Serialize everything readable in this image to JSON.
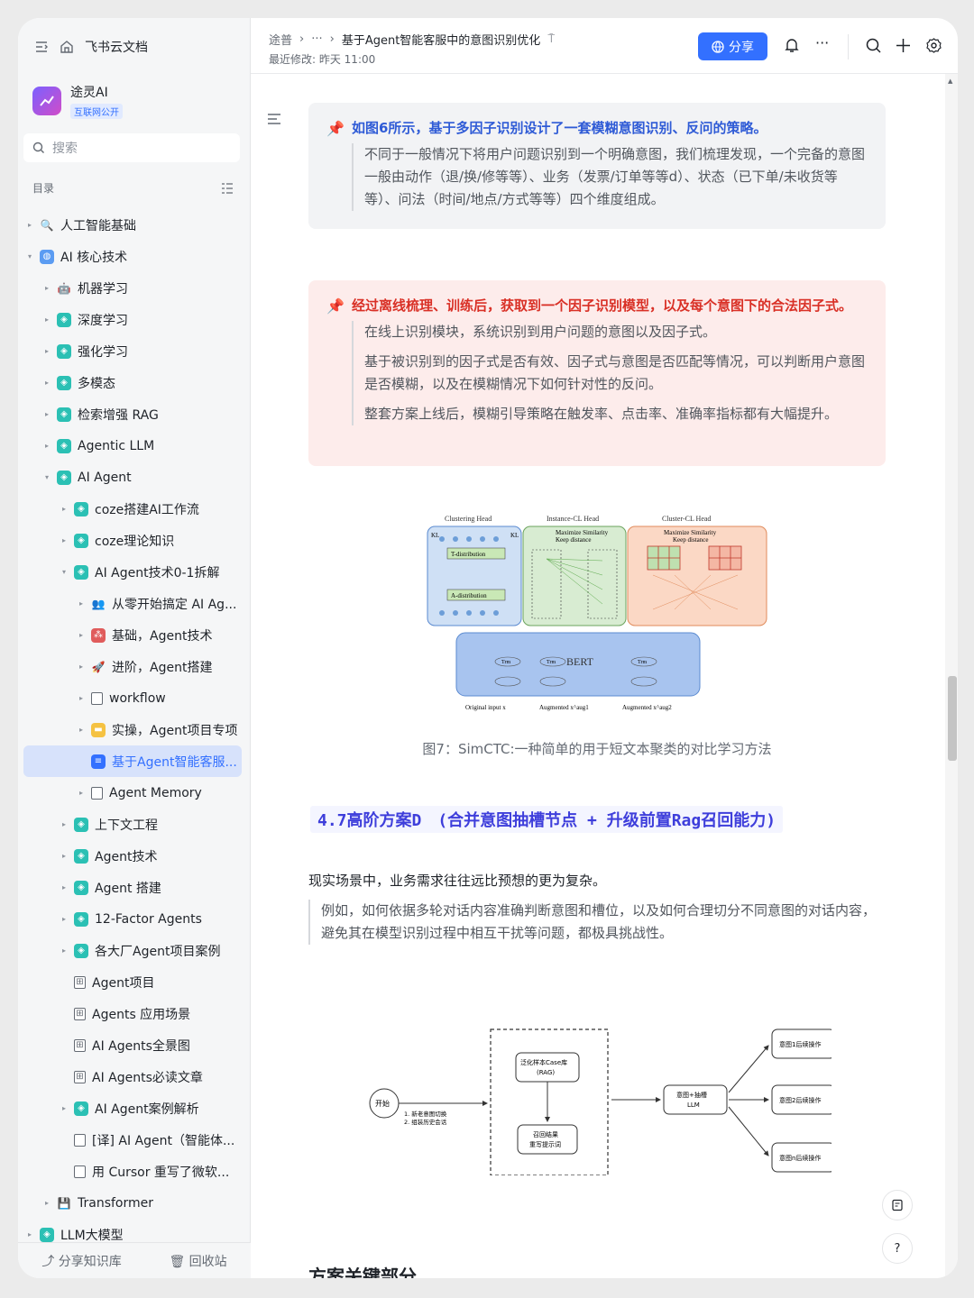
{
  "sidebar": {
    "app_name": "飞书云文档",
    "workspace": {
      "name": "途灵AI",
      "tag": "互联网公开"
    },
    "search_placeholder": "搜索",
    "toc_label": "目录",
    "tree": [
      {
        "label": "人工智能基础",
        "level": 0,
        "arrow": "▸",
        "icon": "search-icon"
      },
      {
        "label": "AI 核心技术",
        "level": 0,
        "arrow": "▾",
        "icon": "globe-icon"
      },
      {
        "label": "机器学习",
        "level": 1,
        "arrow": "▸",
        "icon": "robot-icon"
      },
      {
        "label": "深度学习",
        "level": 1,
        "arrow": "▸",
        "icon": "wiki-icon"
      },
      {
        "label": "强化学习",
        "level": 1,
        "arrow": "▸",
        "icon": "wiki-icon"
      },
      {
        "label": "多模态",
        "level": 1,
        "arrow": "▸",
        "icon": "wiki-icon"
      },
      {
        "label": "检索增强 RAG",
        "level": 1,
        "arrow": "▸",
        "icon": "wiki-icon"
      },
      {
        "label": "Agentic LLM",
        "level": 1,
        "arrow": "▸",
        "icon": "wiki-icon"
      },
      {
        "label": "AI Agent",
        "level": 1,
        "arrow": "▾",
        "icon": "wiki-icon"
      },
      {
        "label": "coze搭建AI工作流",
        "level": 2,
        "arrow": "▸",
        "icon": "wiki-icon"
      },
      {
        "label": "coze理论知识",
        "level": 2,
        "arrow": "▸",
        "icon": "wiki-icon"
      },
      {
        "label": "AI Agent技术0-1拆解",
        "level": 2,
        "arrow": "▾",
        "icon": "wiki-icon"
      },
      {
        "label": "从零开始搞定 AI Ag...",
        "level": 3,
        "arrow": "▸",
        "icon": "people-icon"
      },
      {
        "label": "基础，Agent技术",
        "level": 3,
        "arrow": "▸",
        "icon": "dots-icon"
      },
      {
        "label": "进阶，Agent搭建",
        "level": 3,
        "arrow": "▸",
        "icon": "rocket-icon"
      },
      {
        "label": "workflow",
        "level": 3,
        "arrow": "▸",
        "icon": "doc-icon"
      },
      {
        "label": "实操，Agent项目专项",
        "level": 3,
        "arrow": "▸",
        "icon": "note-icon"
      },
      {
        "label": "基于Agent智能客服...",
        "level": 3,
        "arrow": "",
        "icon": "doc-blue-icon",
        "active": true
      },
      {
        "label": "Agent Memory",
        "level": 3,
        "arrow": "▸",
        "icon": "doc-icon"
      },
      {
        "label": "上下文工程",
        "level": 2,
        "arrow": "▸",
        "icon": "wiki-icon"
      },
      {
        "label": "Agent技术",
        "level": 2,
        "arrow": "▸",
        "icon": "wiki-icon"
      },
      {
        "label": "Agent 搭建",
        "level": 2,
        "arrow": "▸",
        "icon": "wiki-icon"
      },
      {
        "label": "12-Factor Agents",
        "level": 2,
        "arrow": "▸",
        "icon": "wiki-icon"
      },
      {
        "label": "各大厂Agent项目案例",
        "level": 2,
        "arrow": "▸",
        "icon": "wiki-icon"
      },
      {
        "label": "Agent项目",
        "level": 2,
        "arrow": "",
        "icon": "board-icon"
      },
      {
        "label": "Agents 应用场景",
        "level": 2,
        "arrow": "",
        "icon": "board-icon"
      },
      {
        "label": "AI Agents全景图",
        "level": 2,
        "arrow": "",
        "icon": "board-icon"
      },
      {
        "label": "AI Agents必读文章",
        "level": 2,
        "arrow": "",
        "icon": "board-icon"
      },
      {
        "label": "AI Agent案例解析",
        "level": 2,
        "arrow": "▸",
        "icon": "wiki-icon"
      },
      {
        "label": "[译] AI Agent（智能体...",
        "level": 2,
        "arrow": "",
        "icon": "doc-icon"
      },
      {
        "label": "用 Cursor 重写了微软...",
        "level": 2,
        "arrow": "",
        "icon": "doc-icon"
      },
      {
        "label": "Transformer",
        "level": 1,
        "arrow": "▸",
        "icon": "floppy-icon"
      },
      {
        "label": "LLM大模型",
        "level": 0,
        "arrow": "▸",
        "icon": "wiki-icon"
      }
    ],
    "footer": {
      "share": "分享知识库",
      "trash": "回收站"
    }
  },
  "header": {
    "breadcrumb": [
      "途普",
      "···",
      "基于Agent智能客服中的意图识别优化"
    ],
    "modified": "最近修改: 昨天 11:00",
    "share_label": "分享"
  },
  "doc": {
    "callout1": {
      "title": "如图6所示，基于多因子识别设计了一套模糊意图识别、反问的策略。",
      "body": [
        "不同于一般情况下将用户问题识别到一个明确意图，我们梳理发现，一个完备的意图一般由动作（退/换/修等等）、业务（发票/订单等等d）、状态（已下单/未收货等等）、问法（时间/地点/方式等等）四个维度组成。"
      ]
    },
    "callout2": {
      "title": "经过离线梳理、训练后，获取到一个因子识别模型，以及每个意图下的合法因子式。",
      "body": [
        "在线上识别模块，系统识别到用户问题的意图以及因子式。",
        "基于被识别到的因子式是否有效、因子式与意图是否匹配等情况，可以判断用户意图是否模糊，以及在模糊情况下如何针对性的反问。",
        "整套方案上线后，模糊引导策略在触发率、点击率、准确率指标都有大幅提升。"
      ]
    },
    "figure1": {
      "heads": [
        "Clustering Head",
        "Instance-CL Head",
        "Cluster-CL Head"
      ],
      "labels": [
        "KL",
        "KL",
        "T-distribution",
        "A-distribution",
        "Maximize Similarity",
        "Keep distance",
        "Maximize Similarity",
        "Keep distance",
        "BERT",
        "Trm",
        "Original input x",
        "Augmented x^aug1",
        "Augmented x^aug2"
      ],
      "caption": "图7：SimCTC:一种简单的用于短文本聚类的对比学习方法"
    },
    "section_heading": "4.7高阶方案D　(合并意图抽槽节点 + 升级前置Rag召回能力)",
    "paragraph": "现实场景中，业务需求往往远比预想的更为复杂。",
    "quote": "例如，如何依据多轮对话内容准确判断意图和槽位，以及如何合理切分不同意图的对话内容，避免其在模型识别过程中相互干扰等问题，都极具挑战性。",
    "figure2": {
      "start": "开始",
      "notes": [
        "1. 新老意图切换",
        "2. 组装历史会话"
      ],
      "rag": [
        "泛化样本Case库",
        "(RAG)"
      ],
      "recall": [
        "召回结果",
        "重写提示词"
      ],
      "llm": [
        "意图+抽槽",
        "LLM"
      ],
      "outs": [
        "意图1后续操作",
        "意图2后续操作",
        "意图n后续操作"
      ]
    },
    "key_heading": "方案关键部分"
  },
  "colors": {
    "accent": "#3370ff",
    "heading_blue": "#2f5bd6",
    "heading_red": "#d93026"
  }
}
